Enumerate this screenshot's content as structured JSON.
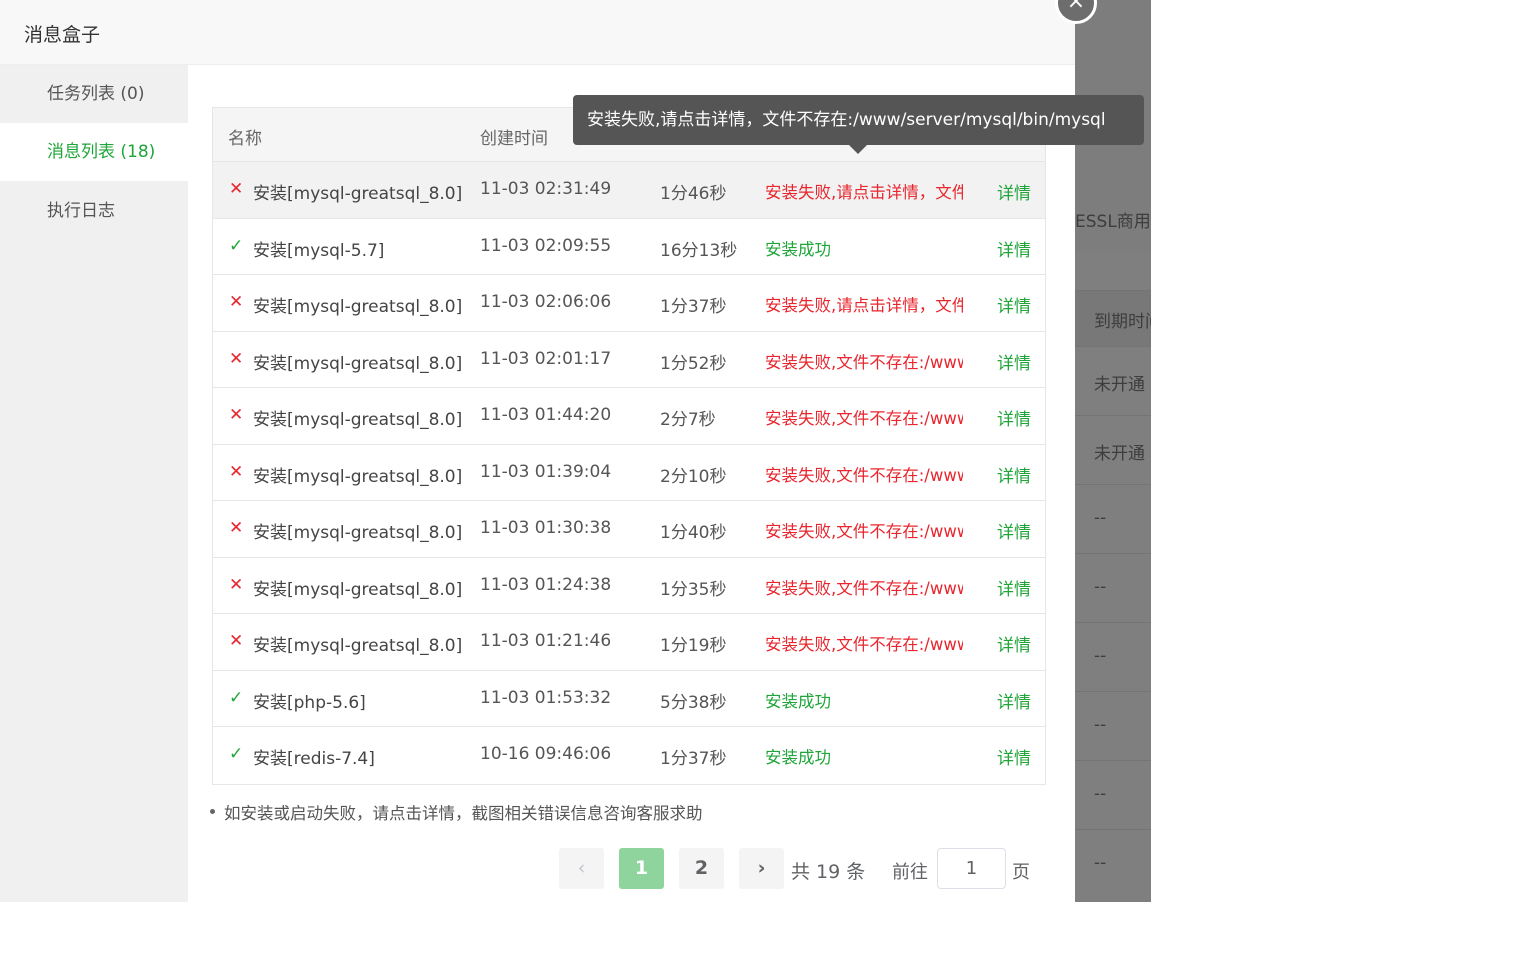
{
  "dialog": {
    "title": "消息盒子",
    "close_icon": "×"
  },
  "sidebar": {
    "items": [
      {
        "label": "任务列表 (0)",
        "active": false
      },
      {
        "label": "消息列表 (18)",
        "active": true
      },
      {
        "label": "执行日志",
        "active": false
      }
    ]
  },
  "table": {
    "headers": {
      "name": "名称",
      "created": "创建时间"
    },
    "rows": [
      {
        "status": "fail",
        "icon": "✕",
        "name": "安装[mysql-greatsql_8.0]",
        "time": "11-03 02:31:49",
        "duration": "1分46秒",
        "result": "安装失败,请点击详情，文件不存在:/www/server/mysql/bin/mysql",
        "detail": "详情"
      },
      {
        "status": "ok",
        "icon": "✓",
        "name": "安装[mysql-5.7]",
        "time": "11-03 02:09:55",
        "duration": "16分13秒",
        "result": "安装成功",
        "detail": "详情"
      },
      {
        "status": "fail",
        "icon": "✕",
        "name": "安装[mysql-greatsql_8.0]",
        "time": "11-03 02:06:06",
        "duration": "1分37秒",
        "result": "安装失败,请点击详情，文件不存在",
        "detail": "详情"
      },
      {
        "status": "fail",
        "icon": "✕",
        "name": "安装[mysql-greatsql_8.0]",
        "time": "11-03 02:01:17",
        "duration": "1分52秒",
        "result": "安装失败,文件不存在:/www/server",
        "detail": "详情"
      },
      {
        "status": "fail",
        "icon": "✕",
        "name": "安装[mysql-greatsql_8.0]",
        "time": "11-03 01:44:20",
        "duration": "2分7秒",
        "result": "安装失败,文件不存在:/www/server",
        "detail": "详情"
      },
      {
        "status": "fail",
        "icon": "✕",
        "name": "安装[mysql-greatsql_8.0]",
        "time": "11-03 01:39:04",
        "duration": "2分10秒",
        "result": "安装失败,文件不存在:/www/server",
        "detail": "详情"
      },
      {
        "status": "fail",
        "icon": "✕",
        "name": "安装[mysql-greatsql_8.0]",
        "time": "11-03 01:30:38",
        "duration": "1分40秒",
        "result": "安装失败,文件不存在:/www/server",
        "detail": "详情"
      },
      {
        "status": "fail",
        "icon": "✕",
        "name": "安装[mysql-greatsql_8.0]",
        "time": "11-03 01:24:38",
        "duration": "1分35秒",
        "result": "安装失败,文件不存在:/www/server",
        "detail": "详情"
      },
      {
        "status": "fail",
        "icon": "✕",
        "name": "安装[mysql-greatsql_8.0]",
        "time": "11-03 01:21:46",
        "duration": "1分19秒",
        "result": "安装失败,文件不存在:/www/server",
        "detail": "详情"
      },
      {
        "status": "ok",
        "icon": "✓",
        "name": "安装[php-5.6]",
        "time": "11-03 01:53:32",
        "duration": "5分38秒",
        "result": "安装成功",
        "detail": "详情"
      },
      {
        "status": "ok",
        "icon": "✓",
        "name": "安装[redis-7.4]",
        "time": "10-16 09:46:06",
        "duration": "1分37秒",
        "result": "安装成功",
        "detail": "详情"
      }
    ]
  },
  "note": "如安装或启动失败，请点击详情，截图相关错误信息咨询客服求助",
  "pager": {
    "prev": "‹",
    "pages": [
      "1",
      "2"
    ],
    "current_page": "1",
    "next": "›",
    "total": "共 19 条",
    "goto_label": "前往",
    "goto_value": "1",
    "unit": "页"
  },
  "tooltip": "安装失败,请点击详情，文件不存在:/www/server/mysql/bin/mysql",
  "background_page": {
    "banner_text": "ESSL商用证",
    "column_header": "到期时间",
    "cells": [
      "未开通",
      "未开通",
      "--",
      "--",
      "--",
      "--",
      "--",
      "--"
    ]
  },
  "colors": {
    "accent_green": "#20a53a",
    "error_red": "#e8262e",
    "tooltip_bg": "#555555",
    "overlay": "#7f7f7f"
  }
}
